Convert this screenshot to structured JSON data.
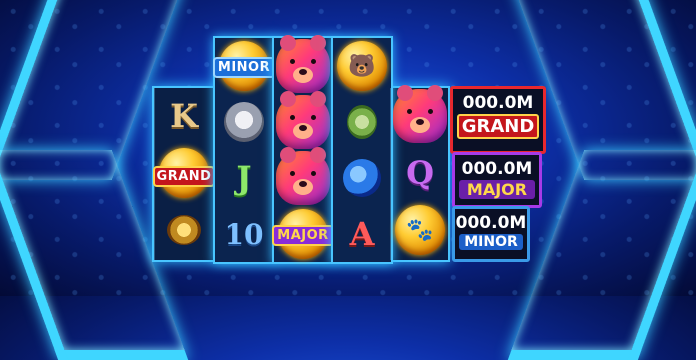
{
  "game": {
    "reels": [
      {
        "id": "reel-1",
        "tall": false,
        "symbols": [
          {
            "kind": "letter",
            "text": "K",
            "cls": "l-k",
            "name": "symbol-k"
          },
          {
            "kind": "coin",
            "label": "GRAND",
            "labelCls": "grand",
            "name": "symbol-grand-coin"
          },
          {
            "kind": "animal",
            "cls": "bee",
            "name": "symbol-bee"
          }
        ]
      },
      {
        "id": "reel-2",
        "tall": true,
        "symbols": [
          {
            "kind": "coin",
            "label": "MINOR",
            "labelCls": "minor",
            "name": "symbol-minor-coin"
          },
          {
            "kind": "animal",
            "cls": "raccoon",
            "name": "symbol-raccoon"
          },
          {
            "kind": "letter",
            "text": "J",
            "cls": "l-j",
            "name": "symbol-j"
          },
          {
            "kind": "letter",
            "text": "10",
            "cls": "l-10",
            "name": "symbol-10"
          }
        ]
      },
      {
        "id": "reel-3",
        "tall": true,
        "symbols": [
          {
            "kind": "bear",
            "name": "symbol-bear"
          },
          {
            "kind": "bear",
            "name": "symbol-bear"
          },
          {
            "kind": "bear",
            "name": "symbol-bear"
          },
          {
            "kind": "coin",
            "label": "MAJOR",
            "labelCls": "major",
            "name": "symbol-major-coin"
          }
        ]
      },
      {
        "id": "reel-4",
        "tall": true,
        "symbols": [
          {
            "kind": "coin",
            "label": "",
            "name": "symbol-bear-coin"
          },
          {
            "kind": "animal",
            "cls": "mouse",
            "name": "symbol-mouse"
          },
          {
            "kind": "animal",
            "cls": "bird",
            "name": "symbol-bluejay"
          },
          {
            "kind": "letter",
            "text": "A",
            "cls": "l-a",
            "name": "symbol-a"
          }
        ]
      },
      {
        "id": "reel-5",
        "tall": false,
        "symbols": [
          {
            "kind": "bear",
            "name": "symbol-bear"
          },
          {
            "kind": "letter",
            "text": "Q",
            "cls": "l-q",
            "name": "symbol-q"
          },
          {
            "kind": "coin",
            "label": "",
            "paw": true,
            "name": "symbol-paw-coin"
          }
        ]
      }
    ]
  },
  "jackpots": {
    "grand": {
      "amount": "000.0M",
      "name": "GRAND"
    },
    "major": {
      "amount": "000.0M",
      "name": "MAJOR"
    },
    "minor": {
      "amount": "000.0M",
      "name": "MINOR"
    }
  },
  "colors": {
    "grand": "#c4161c",
    "major": "#8a2bd8",
    "minor": "#1c6fd8",
    "frame": "#3fd6ff"
  }
}
